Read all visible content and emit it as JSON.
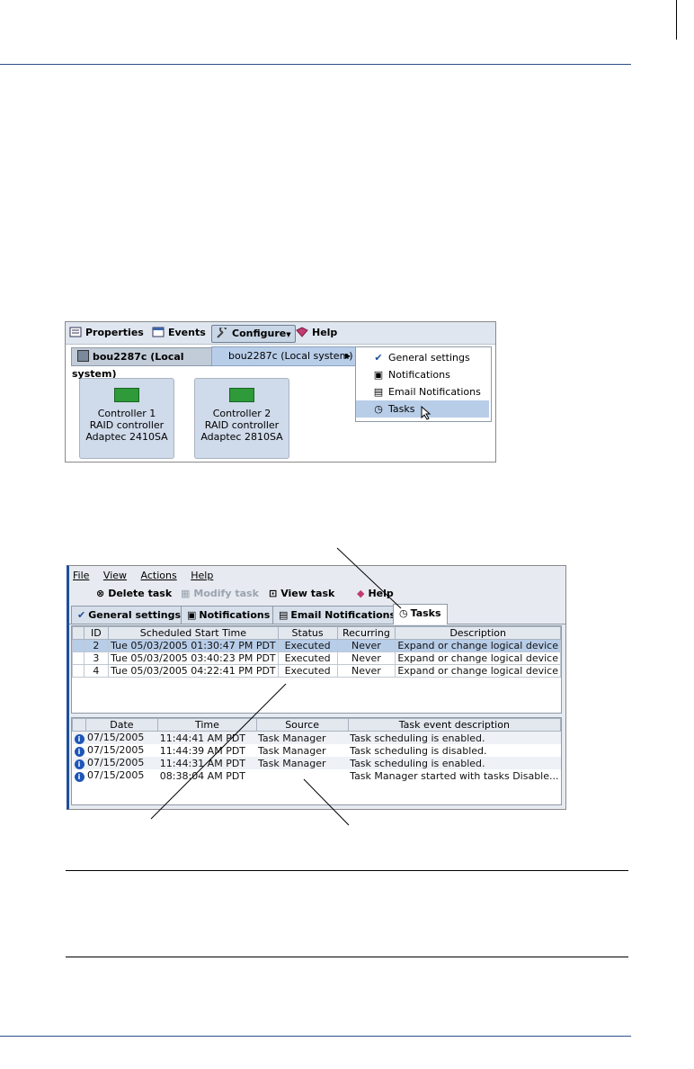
{
  "shot1": {
    "toolbar": {
      "properties": "Properties",
      "events": "Events",
      "configure": "Configure",
      "help": "Help"
    },
    "system_label": "bou2287c (Local system)",
    "submenu_system": "bou2287c (Local system)",
    "menu_items": [
      {
        "label": "General settings",
        "icon": "checkmark-icon"
      },
      {
        "label": "Notifications",
        "icon": "computer-icon"
      },
      {
        "label": "Email Notifications",
        "icon": "email-icon"
      },
      {
        "label": "Tasks",
        "icon": "clock-icon",
        "selected": true
      }
    ],
    "controllers": [
      {
        "line1": "Controller 1",
        "line2": "RAID controller",
        "line3": "Adaptec 2410SA"
      },
      {
        "line1": "Controller 2",
        "line2": "RAID controller",
        "line3": "Adaptec 2810SA"
      }
    ]
  },
  "shot2": {
    "menubar": [
      "File",
      "View",
      "Actions",
      "Help"
    ],
    "toolbar": {
      "delete": "Delete task",
      "modify": "Modify task",
      "view": "View task",
      "help": "Help"
    },
    "tabs": [
      "General settings",
      "Notifications",
      "Email Notifications",
      "Tasks"
    ],
    "task_columns": [
      "ID",
      "Scheduled Start Time",
      "Status",
      "Recurring",
      "Description"
    ],
    "task_rows": [
      {
        "id": "2",
        "time": "Tue 05/03/2005 01:30:47 PM PDT",
        "status": "Executed",
        "recurring": "Never",
        "desc": "Expand or change logical device"
      },
      {
        "id": "3",
        "time": "Tue 05/03/2005 03:40:23 PM PDT",
        "status": "Executed",
        "recurring": "Never",
        "desc": "Expand or change logical device"
      },
      {
        "id": "4",
        "time": "Tue 05/03/2005 04:22:41 PM PDT",
        "status": "Executed",
        "recurring": "Never",
        "desc": "Expand or change logical device"
      }
    ],
    "event_columns": [
      "Date",
      "Time",
      "Source",
      "Task event description"
    ],
    "event_rows": [
      {
        "date": "07/15/2005",
        "time": "11:44:41 AM PDT",
        "source": "Task Manager",
        "desc": "Task scheduling is enabled."
      },
      {
        "date": "07/15/2005",
        "time": "11:44:39 AM PDT",
        "source": "Task Manager",
        "desc": "Task scheduling is disabled."
      },
      {
        "date": "07/15/2005",
        "time": "11:44:31 AM PDT",
        "source": "Task Manager",
        "desc": "Task scheduling is enabled."
      },
      {
        "date": "07/15/2005",
        "time": "08:38:04 AM PDT",
        "source": "",
        "desc": "Task Manager started with tasks Disable..."
      }
    ]
  },
  "colors": {
    "rule": "#2d4f8a",
    "selection": "#b8cde8",
    "accent_border": "#1d4f9c"
  }
}
